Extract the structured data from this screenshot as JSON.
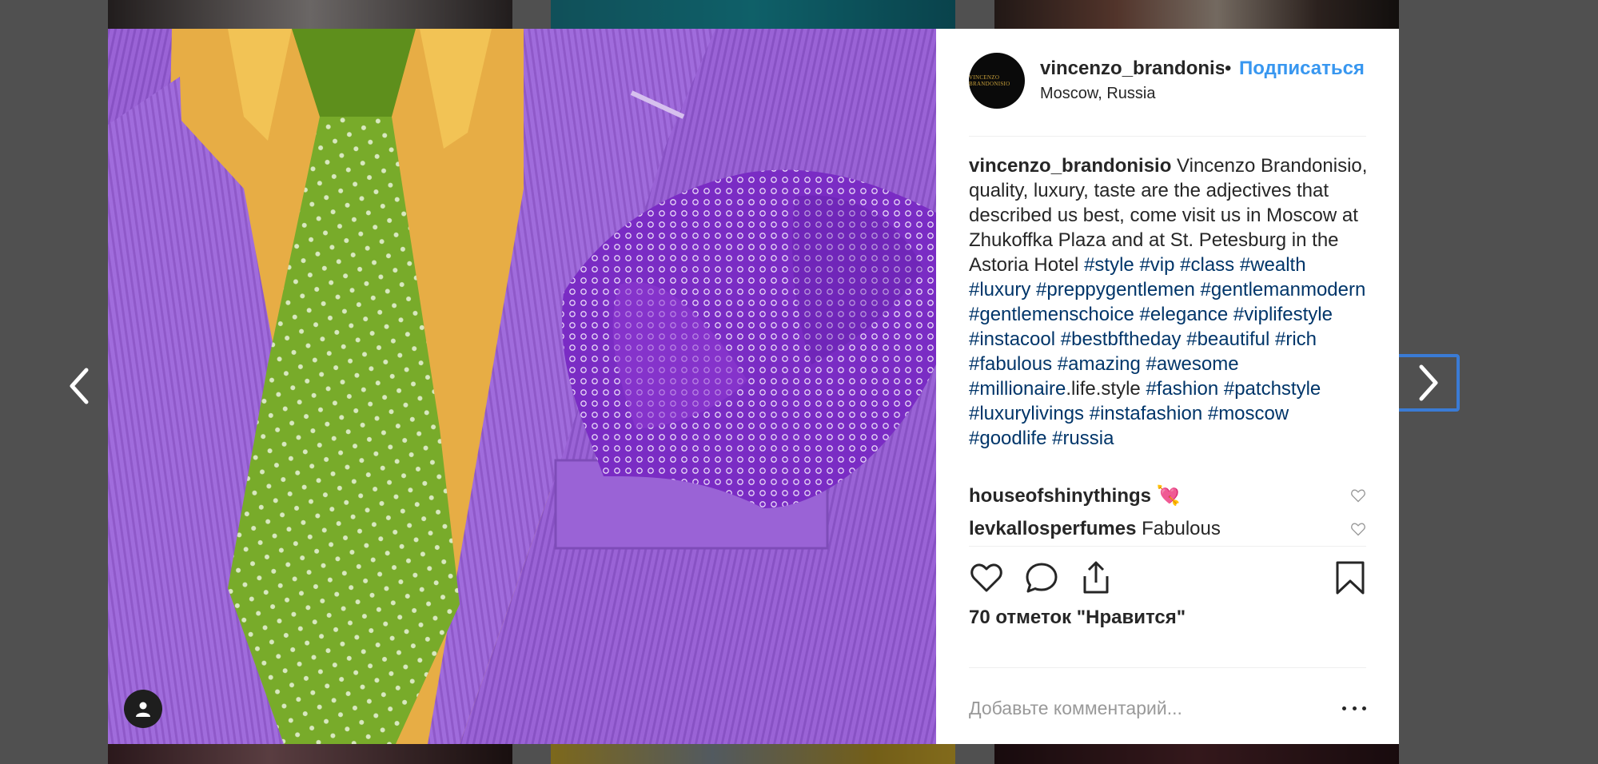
{
  "post": {
    "username": "vincenzo_brandonisio",
    "dot": "•",
    "follow_label": "Подписаться",
    "location": "Moscow, Russia",
    "avatar_text": "VINCENZO BRANDONISIO"
  },
  "caption": {
    "username": "vincenzo_brandonisio",
    "text": "Vincenzo Brandonisio, quality, luxury, taste are the adjectives that described us best, come visit us in Moscow at Zhukoffka Plaza and at St. Petesburg in the Astoria Hotel",
    "hashtags_a": [
      "#style",
      "#vip",
      "#class",
      "#wealth",
      "#luxury",
      "#preppygentlemen",
      "#gentlemanmodern",
      "#gentlemenschoice",
      "#elegance",
      "#viplifestyle",
      "#instacool",
      "#bestbftheday",
      "#beautiful",
      "#rich",
      "#fabulous",
      "#amazing",
      "#awesome",
      "#millionaire"
    ],
    "plain_text": ".life.style",
    "hashtags_b": [
      "#fashion",
      "#patchstyle",
      "#luxurylivings",
      "#instafashion",
      "#moscow",
      "#goodlife",
      "#russia"
    ]
  },
  "comments": [
    {
      "username": "houseofshinythings",
      "text": "💘"
    },
    {
      "username": "levkallosperfumes",
      "text": "Fabulous"
    }
  ],
  "likes_label": "70 отметок \"Нравится\"",
  "comment_placeholder": "Добавьте комментарий...",
  "colors": {
    "link": "#003569",
    "follow": "#3897f0",
    "text": "#262626",
    "nav_highlight": "#3a7bd5"
  },
  "icons": {
    "prev": "chevron-left-icon",
    "next": "chevron-right-icon",
    "like": "heart-icon",
    "comment": "comment-icon",
    "share": "share-icon",
    "save": "bookmark-icon",
    "user_tag": "user-icon",
    "more": "more-icon"
  }
}
